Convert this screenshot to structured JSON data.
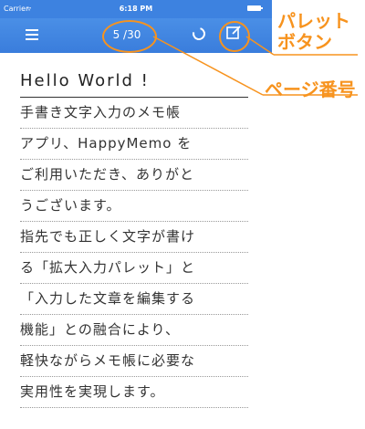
{
  "status_bar": {
    "carrier": "Carrier",
    "time": "6:18 PM"
  },
  "nav": {
    "page_counter": "5 /30"
  },
  "callouts": {
    "palette_button": [
      "パレット",
      "ボタン"
    ],
    "page_number": "ページ番号",
    "color": "#f7931e"
  },
  "memo": {
    "title": "Hello World !",
    "lines": [
      "手書き文字入力のメモ帳",
      "アプリ、HappyMemo を",
      "ご利用いただき、ありがと",
      "うございます。",
      "指先でも正しく文字が書け",
      "る「拡大入力パレット」と",
      "「入力した文章を編集する",
      "機能」との融合により、",
      "軽快ながらメモ帳に必要な",
      "実用性を実現します。"
    ]
  },
  "colors": {
    "nav_blue": "#3d82e0",
    "accent_orange": "#f7931e"
  },
  "icons": [
    "menu-icon",
    "sync-icon",
    "edit-icon",
    "wifi-icon",
    "battery-icon"
  ]
}
